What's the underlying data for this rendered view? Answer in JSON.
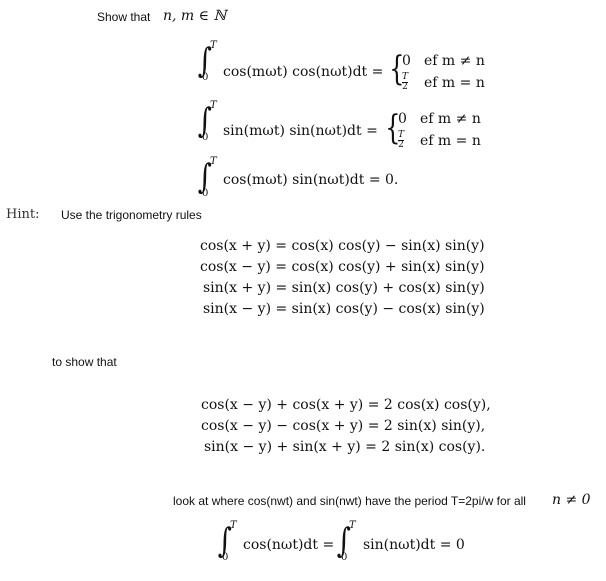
{
  "header": {
    "show_that": "Show that",
    "condition": "n, m ∈ ℕ"
  },
  "integrals": [
    {
      "integrand": "cos(mωt) cos(nωt)dt =",
      "upper": "T",
      "lower": "0",
      "cases": [
        {
          "value": "0",
          "condition": "ef m ≠ n"
        },
        {
          "value_num": "T",
          "value_den": "2",
          "condition": "ef m = n"
        }
      ]
    },
    {
      "integrand": "sin(mωt) sin(nωt)dt =",
      "upper": "T",
      "lower": "0",
      "cases": [
        {
          "value": "0",
          "condition": "ef m ≠ n"
        },
        {
          "value_num": "T",
          "value_den": "2",
          "condition": "ef m = n"
        }
      ]
    },
    {
      "integrand": "cos(mωt) sin(nωt)dt = 0.",
      "upper": "T",
      "lower": "0"
    }
  ],
  "hint": {
    "label": "Hint:",
    "text": "Use the trigonometry rules"
  },
  "rules": [
    "cos(x + y) = cos(x) cos(y) − sin(x) sin(y)",
    "cos(x − y) = cos(x) cos(y) + sin(x) sin(y)",
    "sin(x + y) = sin(x) cos(y) + cos(x) sin(y)",
    "sin(x − y) = sin(x) cos(y) − cos(x) sin(y)"
  ],
  "to_show": "to show that",
  "identities": [
    "cos(x − y) + cos(x + y) = 2 cos(x) cos(y),",
    "cos(x − y) − cos(x + y) = 2 sin(x) sin(y),",
    "sin(x − y) + sin(x + y) = 2 sin(x) cos(y)."
  ],
  "period_note": {
    "text": "look at where cos(nwt) and sin(nwt)  have the period T=2pi/w for all",
    "condition": "n ≠ 0"
  },
  "final": {
    "left_integrand": "cos(nωt)dt =",
    "right_integrand": "sin(nωt)dt = 0",
    "upper": "T",
    "lower": "0"
  }
}
